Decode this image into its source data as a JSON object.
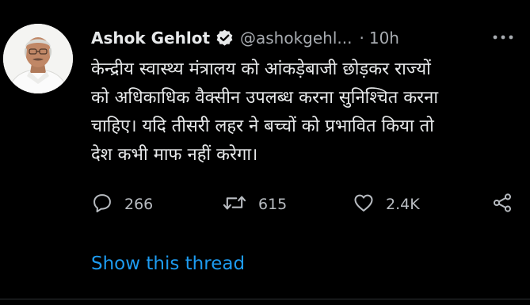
{
  "author": {
    "name": "Ashok Gehlot",
    "handle": "@ashokgehl...",
    "separator": "·",
    "time": "10h"
  },
  "tweet": {
    "lines": [
      "केन्द्रीय स्वास्थ्य मंत्रालय को आंकड़ेबाजी छोड़कर राज्यों",
      "को अधिकाधिक वैक्सीन उपलब्ध करना सुनिश्चित करना",
      "चाहिए। यदि तीसरी लहर ने बच्चों को प्रभावित किया तो",
      "देश कभी माफ नहीं करेगा।"
    ]
  },
  "actions": {
    "replies": "266",
    "retweets": "615",
    "likes": "2.4K"
  },
  "thread_link": "Show this thread",
  "icons": {
    "verified": "verified-badge-icon",
    "more": "more-options-icon",
    "reply": "reply-icon",
    "retweet": "retweet-icon",
    "like": "heart-icon",
    "share": "share-icon"
  },
  "colors": {
    "background": "#000000",
    "text": "#e7e9ea",
    "muted": "#a7abb0",
    "link": "#1d9bf0"
  }
}
